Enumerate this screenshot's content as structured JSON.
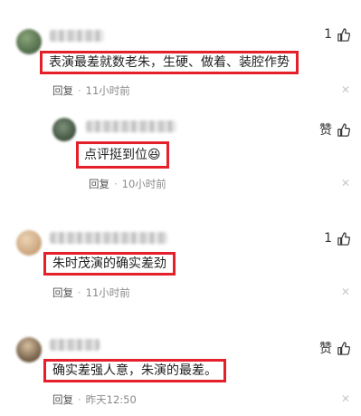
{
  "comments": [
    {
      "likes": "1",
      "text": "表演最差就数老朱，生硬、做着、装腔作势",
      "reply": "回复",
      "time": "11小时前",
      "avatar_color": "#5d7a52"
    },
    {
      "likes": "赞",
      "text": "点评挺到位😆",
      "reply": "回复",
      "time": "10小时前",
      "avatar_color": "#556b55"
    },
    {
      "likes": "1",
      "text": "朱时茂演的确实差劲",
      "reply": "回复",
      "time": "11小时前",
      "avatar_color": "#d8b896"
    },
    {
      "likes": "赞",
      "text": "确实差强人意，朱演的最差。",
      "reply": "回复",
      "time": "昨天12:50",
      "avatar_color": "#a89070"
    }
  ],
  "icons": {
    "like": "thumbs-up-icon",
    "close": "close-icon"
  },
  "colors": {
    "highlight": "#e4202b",
    "meta": "#8a8a8a"
  }
}
